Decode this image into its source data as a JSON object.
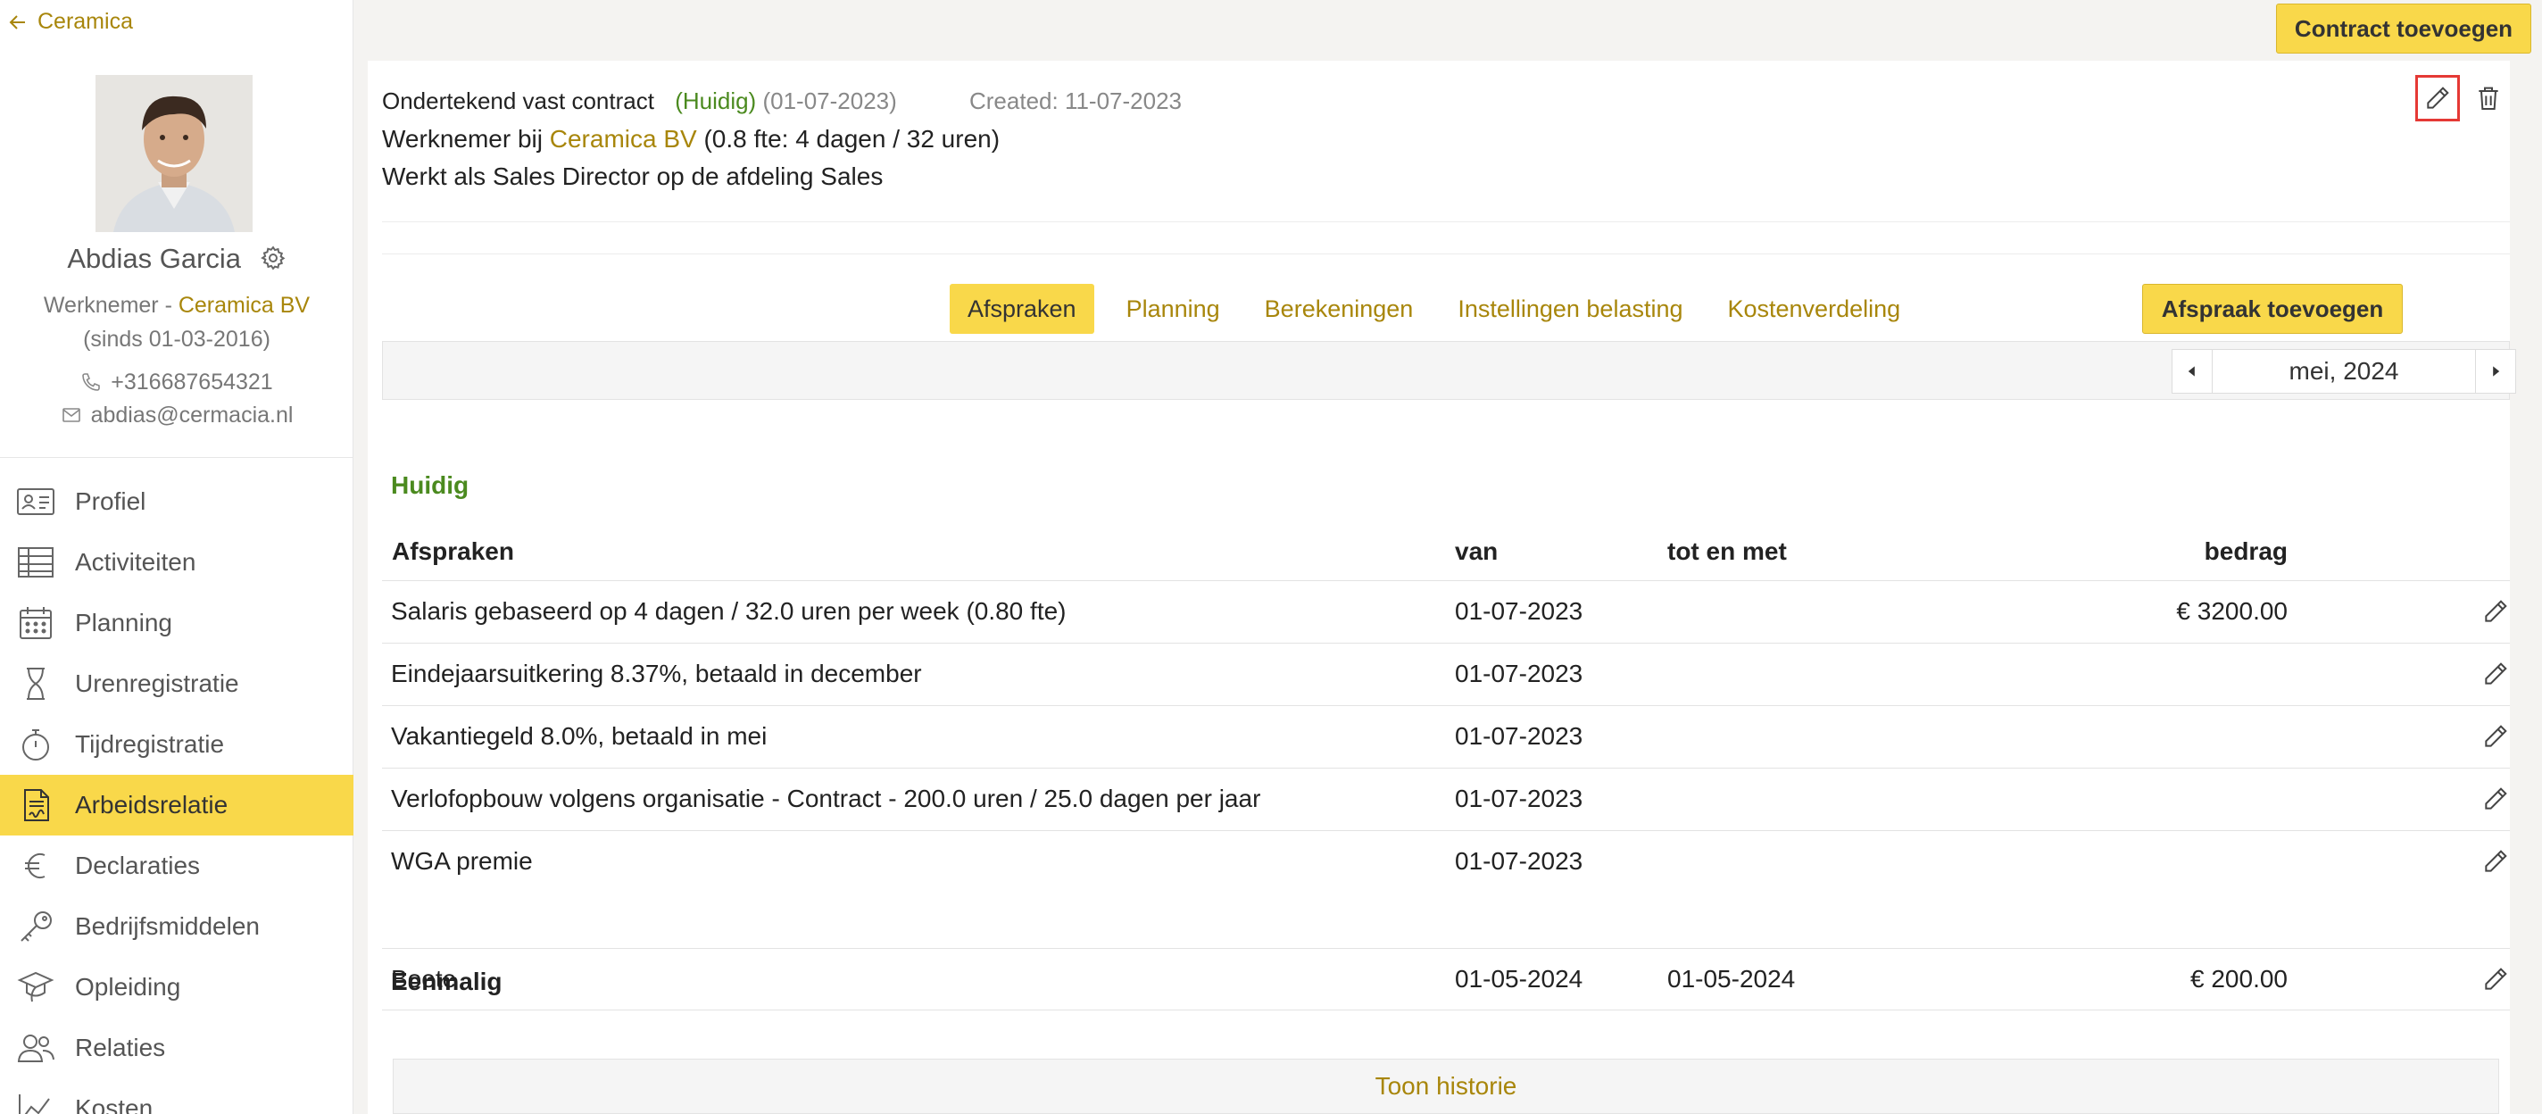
{
  "sidebar": {
    "back_label": "Ceramica",
    "profile": {
      "name": "Abdias Garcia",
      "role_prefix": "Werknemer - ",
      "company": "Ceramica BV",
      "since": "(sinds 01-03-2016)",
      "phone": "+316687654321",
      "email": "abdias@cermacia.nl"
    },
    "nav": [
      {
        "label": "Profiel",
        "icon": "id-card-icon"
      },
      {
        "label": "Activiteiten",
        "icon": "table-icon"
      },
      {
        "label": "Planning",
        "icon": "calendar-icon"
      },
      {
        "label": "Urenregistratie",
        "icon": "hourglass-icon"
      },
      {
        "label": "Tijdregistratie",
        "icon": "stopwatch-icon"
      },
      {
        "label": "Arbeidsrelatie",
        "icon": "contract-icon",
        "active": true
      },
      {
        "label": "Declaraties",
        "icon": "euro-icon"
      },
      {
        "label": "Bedrijfsmiddelen",
        "icon": "key-icon"
      },
      {
        "label": "Opleiding",
        "icon": "graduation-icon"
      },
      {
        "label": "Relaties",
        "icon": "users-icon"
      },
      {
        "label": "Kosten",
        "icon": "chart-icon"
      }
    ]
  },
  "header": {
    "add_contract_label": "Contract toevoegen"
  },
  "contract": {
    "title": "Ondertekend vast contract",
    "status": "(Huidig)",
    "start": "(01-07-2023)",
    "created": "Created: 11-07-2023",
    "line2_prefix": "Werknemer bij ",
    "line2_company": "Ceramica BV",
    "line2_suffix": " (0.8 fte: 4 dagen / 32 uren)",
    "line3": "Werkt als Sales Director op de afdeling Sales"
  },
  "tabs": [
    "Afspraken",
    "Planning",
    "Berekeningen",
    "Instellingen belasting",
    "Kostenverdeling"
  ],
  "add_agreement_label": "Afspraak toevoegen",
  "period": "mei, 2024",
  "table": {
    "section_current": "Huidig",
    "headers": {
      "afspraken": "Afspraken",
      "van": "van",
      "tot": "tot en met",
      "bedrag": "bedrag"
    },
    "rows": [
      {
        "desc": "Salaris gebaseerd op 4 dagen / 32.0 uren per week (0.80 fte)",
        "van": "01-07-2023",
        "tot": "",
        "bedrag": "€ 3200.00"
      },
      {
        "desc": "Eindejaarsuitkering 8.37%, betaald in december",
        "van": "01-07-2023",
        "tot": "",
        "bedrag": ""
      },
      {
        "desc": "Vakantiegeld 8.0%, betaald in mei",
        "van": "01-07-2023",
        "tot": "",
        "bedrag": ""
      },
      {
        "desc": "Verlofopbouw volgens organisatie - Contract - 200.0 uren / 25.0 dagen per jaar",
        "van": "01-07-2023",
        "tot": "",
        "bedrag": ""
      },
      {
        "desc": "WGA premie",
        "van": "01-07-2023",
        "tot": "",
        "bedrag": ""
      }
    ],
    "section_once": "Eenmalig",
    "once_rows": [
      {
        "desc": "Boete",
        "van": "01-05-2024",
        "tot": "01-05-2024",
        "bedrag": "€ 200.00"
      }
    ]
  },
  "history_label": "Toon historie",
  "colors": {
    "accent": "#f9d84a",
    "gold_text": "#a8860b",
    "green": "#4b8a1f",
    "highlight_border": "#e53935"
  }
}
